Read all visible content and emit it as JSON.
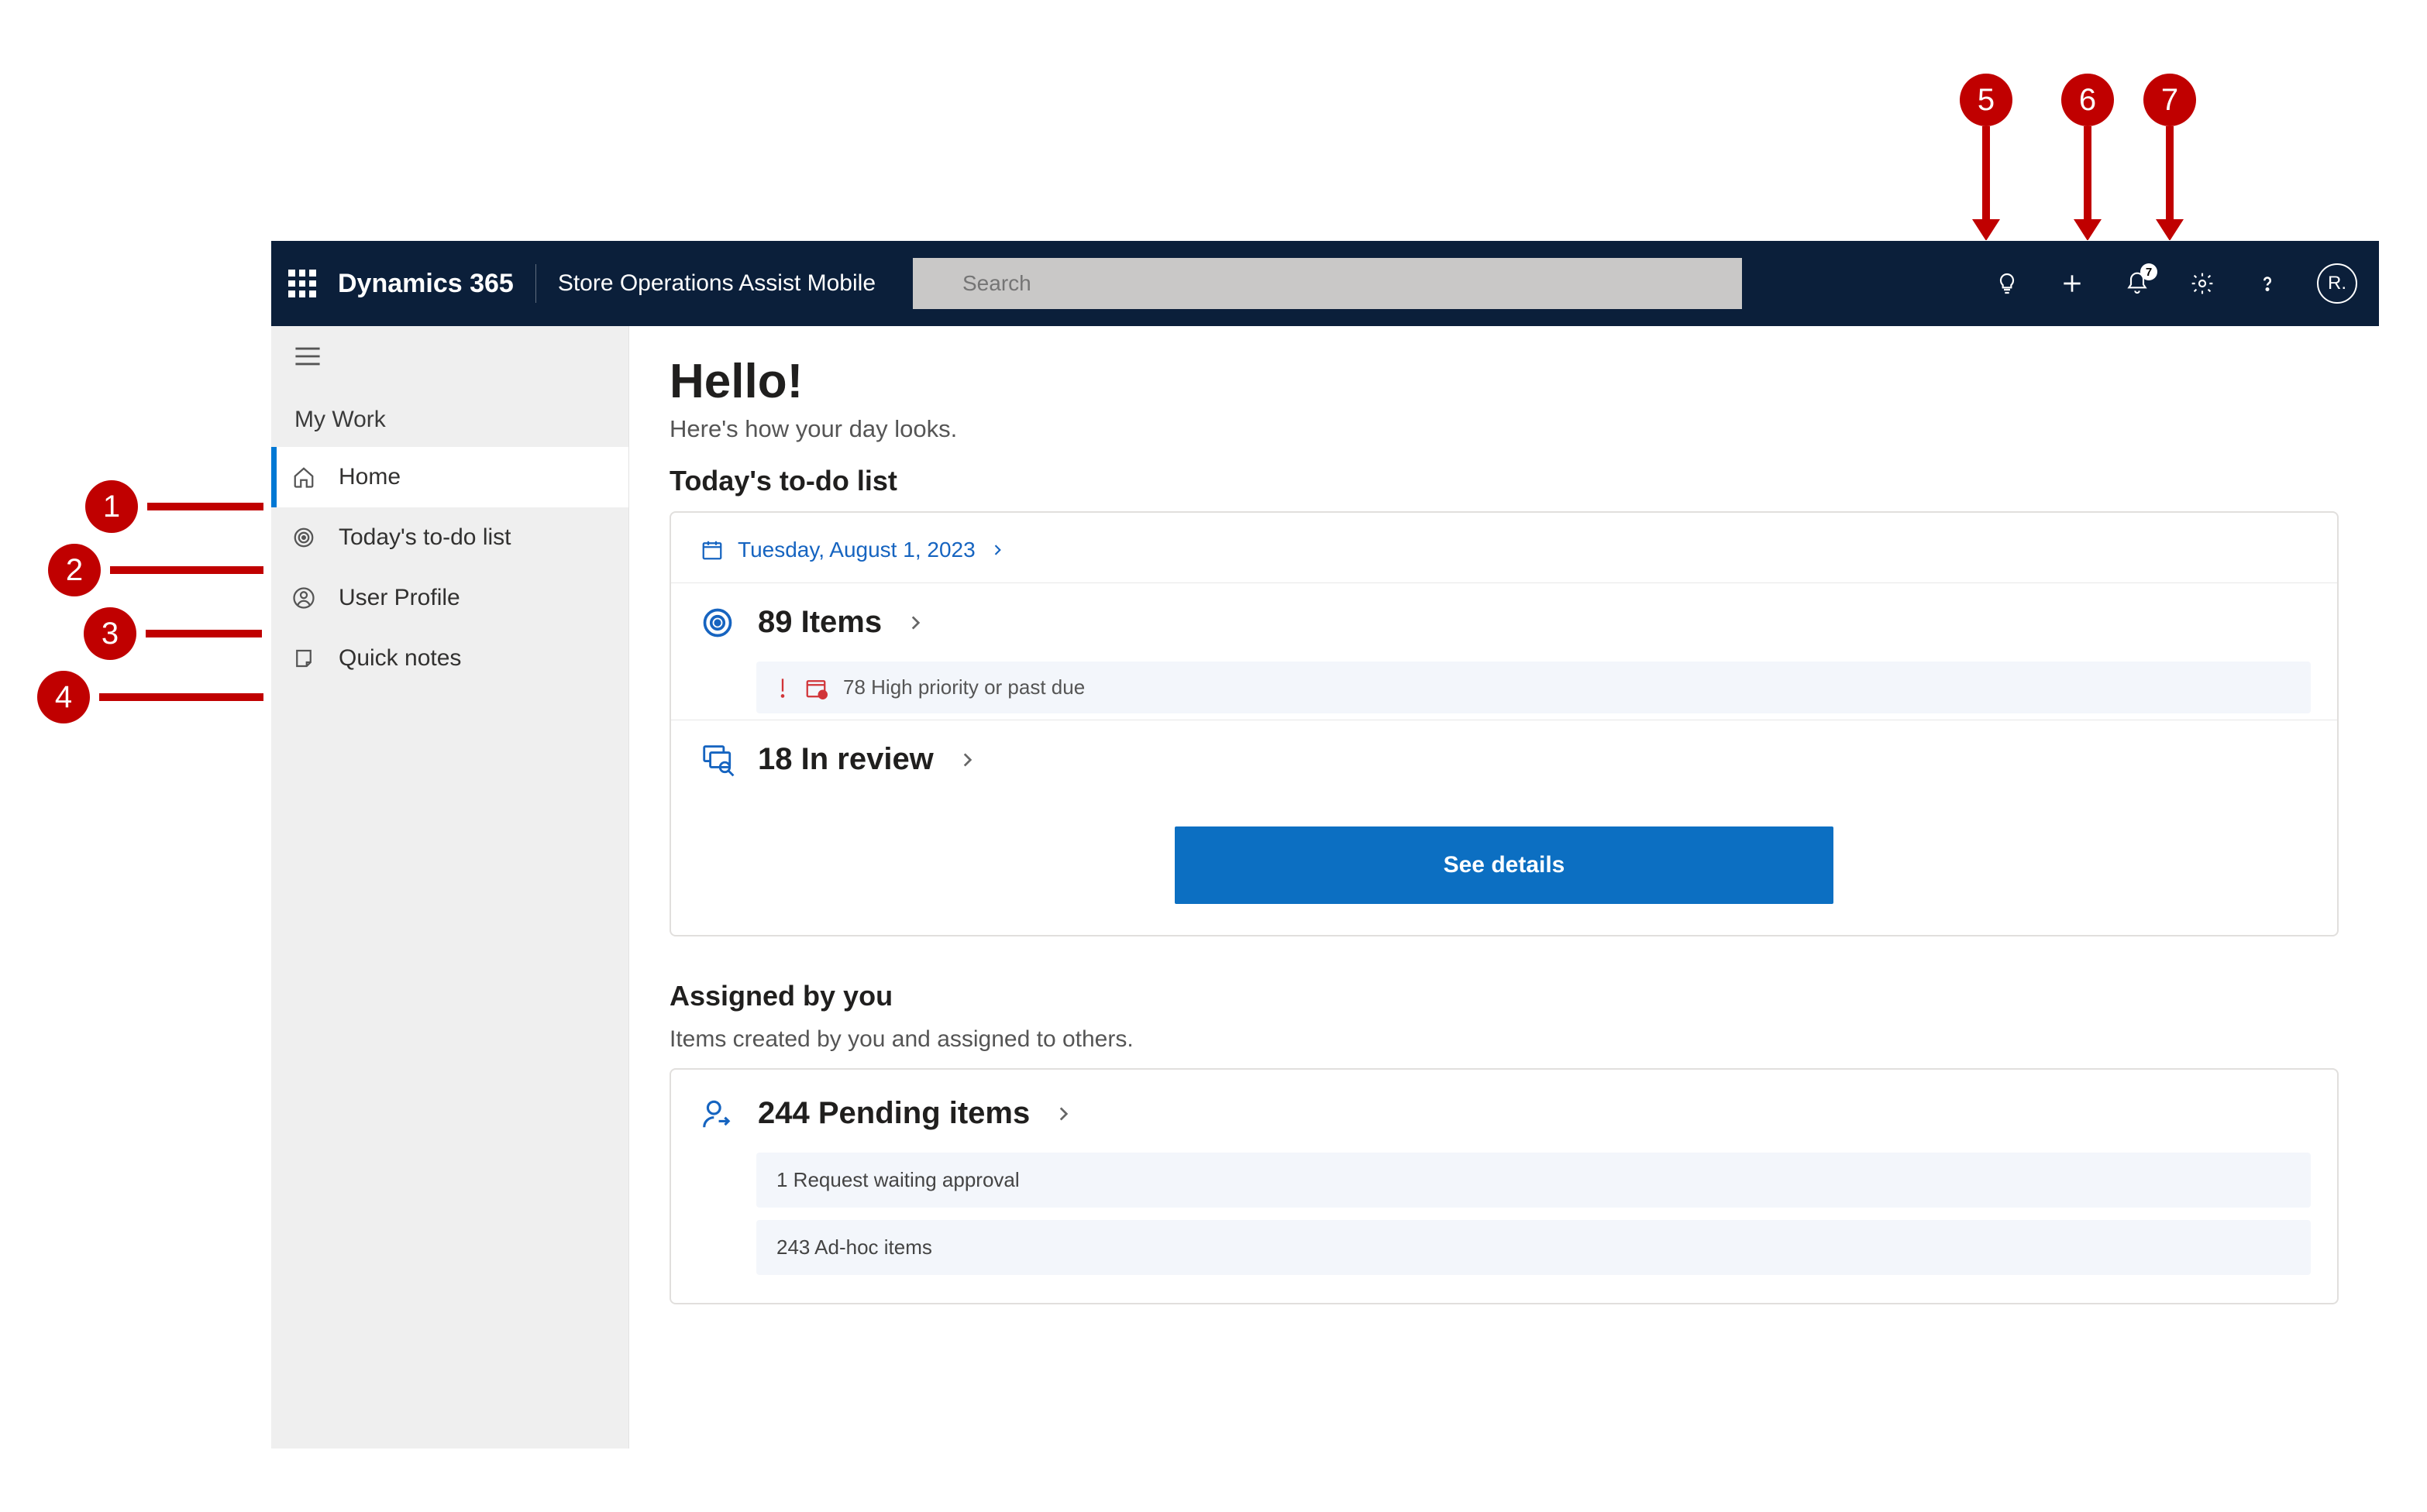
{
  "header": {
    "brand": "Dynamics 365",
    "app_name": "Store Operations Assist Mobile",
    "search_placeholder": "Search",
    "notification_badge": "7",
    "avatar_initial": "R."
  },
  "sidebar": {
    "section_label": "My Work",
    "items": [
      {
        "label": "Home",
        "active": true
      },
      {
        "label": "Today's to-do list",
        "active": false
      },
      {
        "label": "User Profile",
        "active": false
      },
      {
        "label": "Quick notes",
        "active": false
      }
    ]
  },
  "main": {
    "greeting": "Hello!",
    "subtitle": "Here's how your day looks.",
    "todo": {
      "title": "Today's to-do list",
      "date": "Tuesday, August 1, 2023",
      "items_count_label": "89 Items",
      "high_priority_label": "78 High priority or past due",
      "in_review_label": "18 In review",
      "see_details_label": "See details"
    },
    "assigned": {
      "title": "Assigned by you",
      "subtitle": "Items created by you and assigned to others.",
      "pending_label": "244 Pending items",
      "rows": [
        "1 Request waiting approval",
        "243 Ad-hoc items"
      ]
    }
  },
  "callouts": [
    "1",
    "2",
    "3",
    "4",
    "5",
    "6",
    "7"
  ]
}
